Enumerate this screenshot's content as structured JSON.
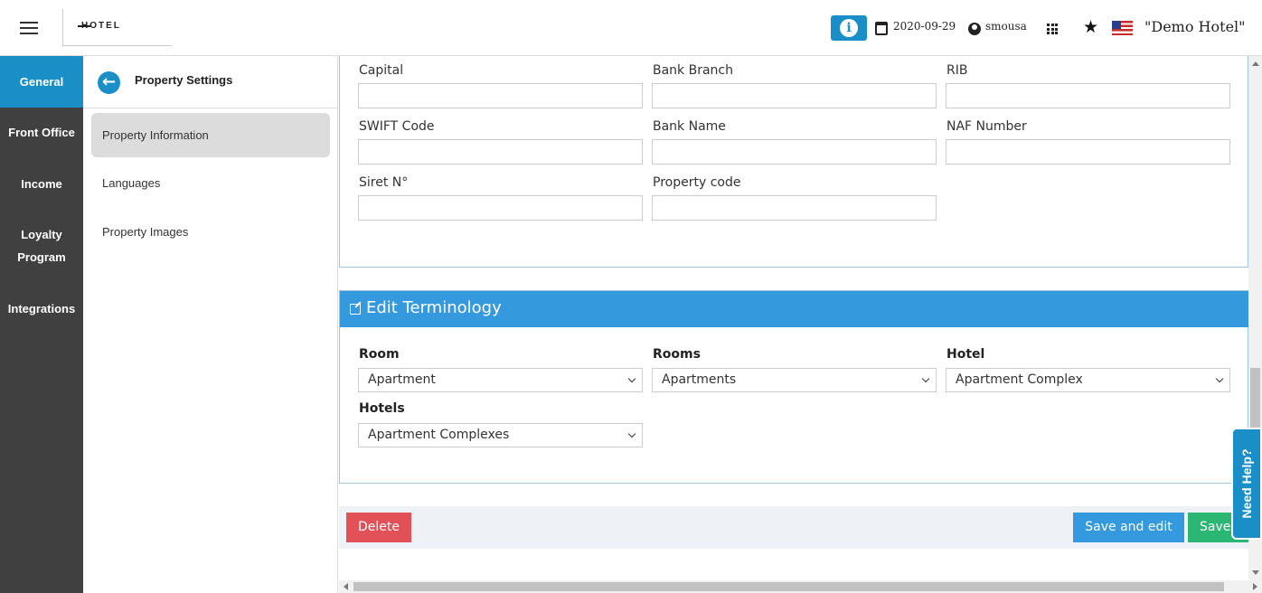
{
  "header": {
    "logo_text": "HOTEL",
    "info_label": "i",
    "date": "2020-09-29",
    "username": "smousa",
    "hotel_name": "\"Demo Hotel\""
  },
  "leftnav": {
    "items": [
      {
        "label": "General",
        "active": true
      },
      {
        "label": "Front Office"
      },
      {
        "label": "Income"
      },
      {
        "label": "Loyalty Program"
      },
      {
        "label": "Integrations"
      }
    ]
  },
  "sidebar": {
    "title": "Property Settings",
    "links": [
      "Property Information",
      "Languages",
      "Property Images"
    ]
  },
  "form": {
    "fields": {
      "capital": {
        "label": "Capital",
        "value": ""
      },
      "bank_branch": {
        "label": "Bank Branch",
        "value": ""
      },
      "rib": {
        "label": "RIB",
        "value": ""
      },
      "swift": {
        "label": "SWIFT Code",
        "value": ""
      },
      "bank_name": {
        "label": "Bank Name",
        "value": ""
      },
      "naf": {
        "label": "NAF Number",
        "value": ""
      },
      "siret": {
        "label": "Siret N°",
        "value": ""
      },
      "property_code": {
        "label": "Property code",
        "value": ""
      }
    }
  },
  "terminology": {
    "title": "Edit Terminology",
    "room": {
      "label": "Room",
      "value": "Apartment"
    },
    "rooms": {
      "label": "Rooms",
      "value": "Apartments"
    },
    "hotel": {
      "label": "Hotel",
      "value": "Apartment Complex"
    },
    "hotels": {
      "label": "Hotels",
      "value": "Apartment Complexes"
    }
  },
  "actions": {
    "delete": "Delete",
    "save_and_edit": "Save and edit",
    "save": "Save"
  },
  "help": {
    "label": "Need Help?"
  },
  "colors": {
    "accent": "#1a8fc7",
    "panel_header": "#3599dd",
    "delete": "#e25058",
    "save": "#2bb673",
    "nav_bg": "#404040"
  }
}
